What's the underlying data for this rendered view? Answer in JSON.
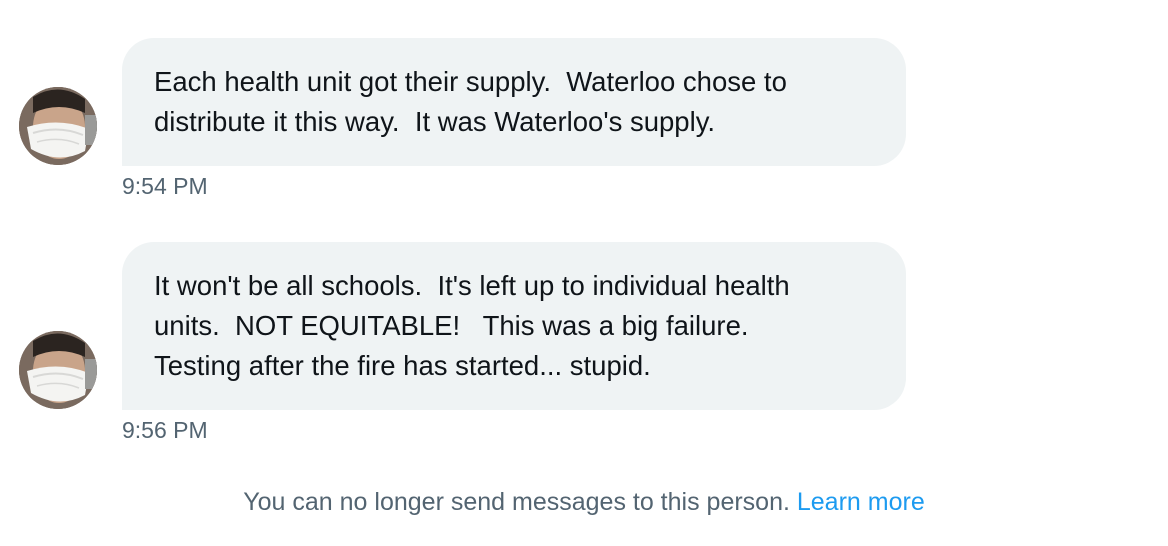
{
  "messages": [
    {
      "avatar_icon": "user-avatar-masked",
      "lines": [
        "Each health unit got their supply.  Waterloo chose to",
        "distribute it this way.  It was Waterloo's supply."
      ],
      "time": "9:54 PM"
    },
    {
      "avatar_icon": "user-avatar-masked",
      "lines": [
        "It won't be all schools.  It's left up to individual health",
        "units.  NOT EQUITABLE!   This was a big failure.",
        "Testing after the fire has started... stupid."
      ],
      "time": "9:56 PM"
    }
  ],
  "footer": {
    "notice_text": "You can no longer send messages to this person.",
    "learn_more_label": "Learn more"
  },
  "colors": {
    "bubble_bg": "#eff3f4",
    "text": "#0f1419",
    "secondary_text": "#536471",
    "link": "#1d9bf0"
  }
}
